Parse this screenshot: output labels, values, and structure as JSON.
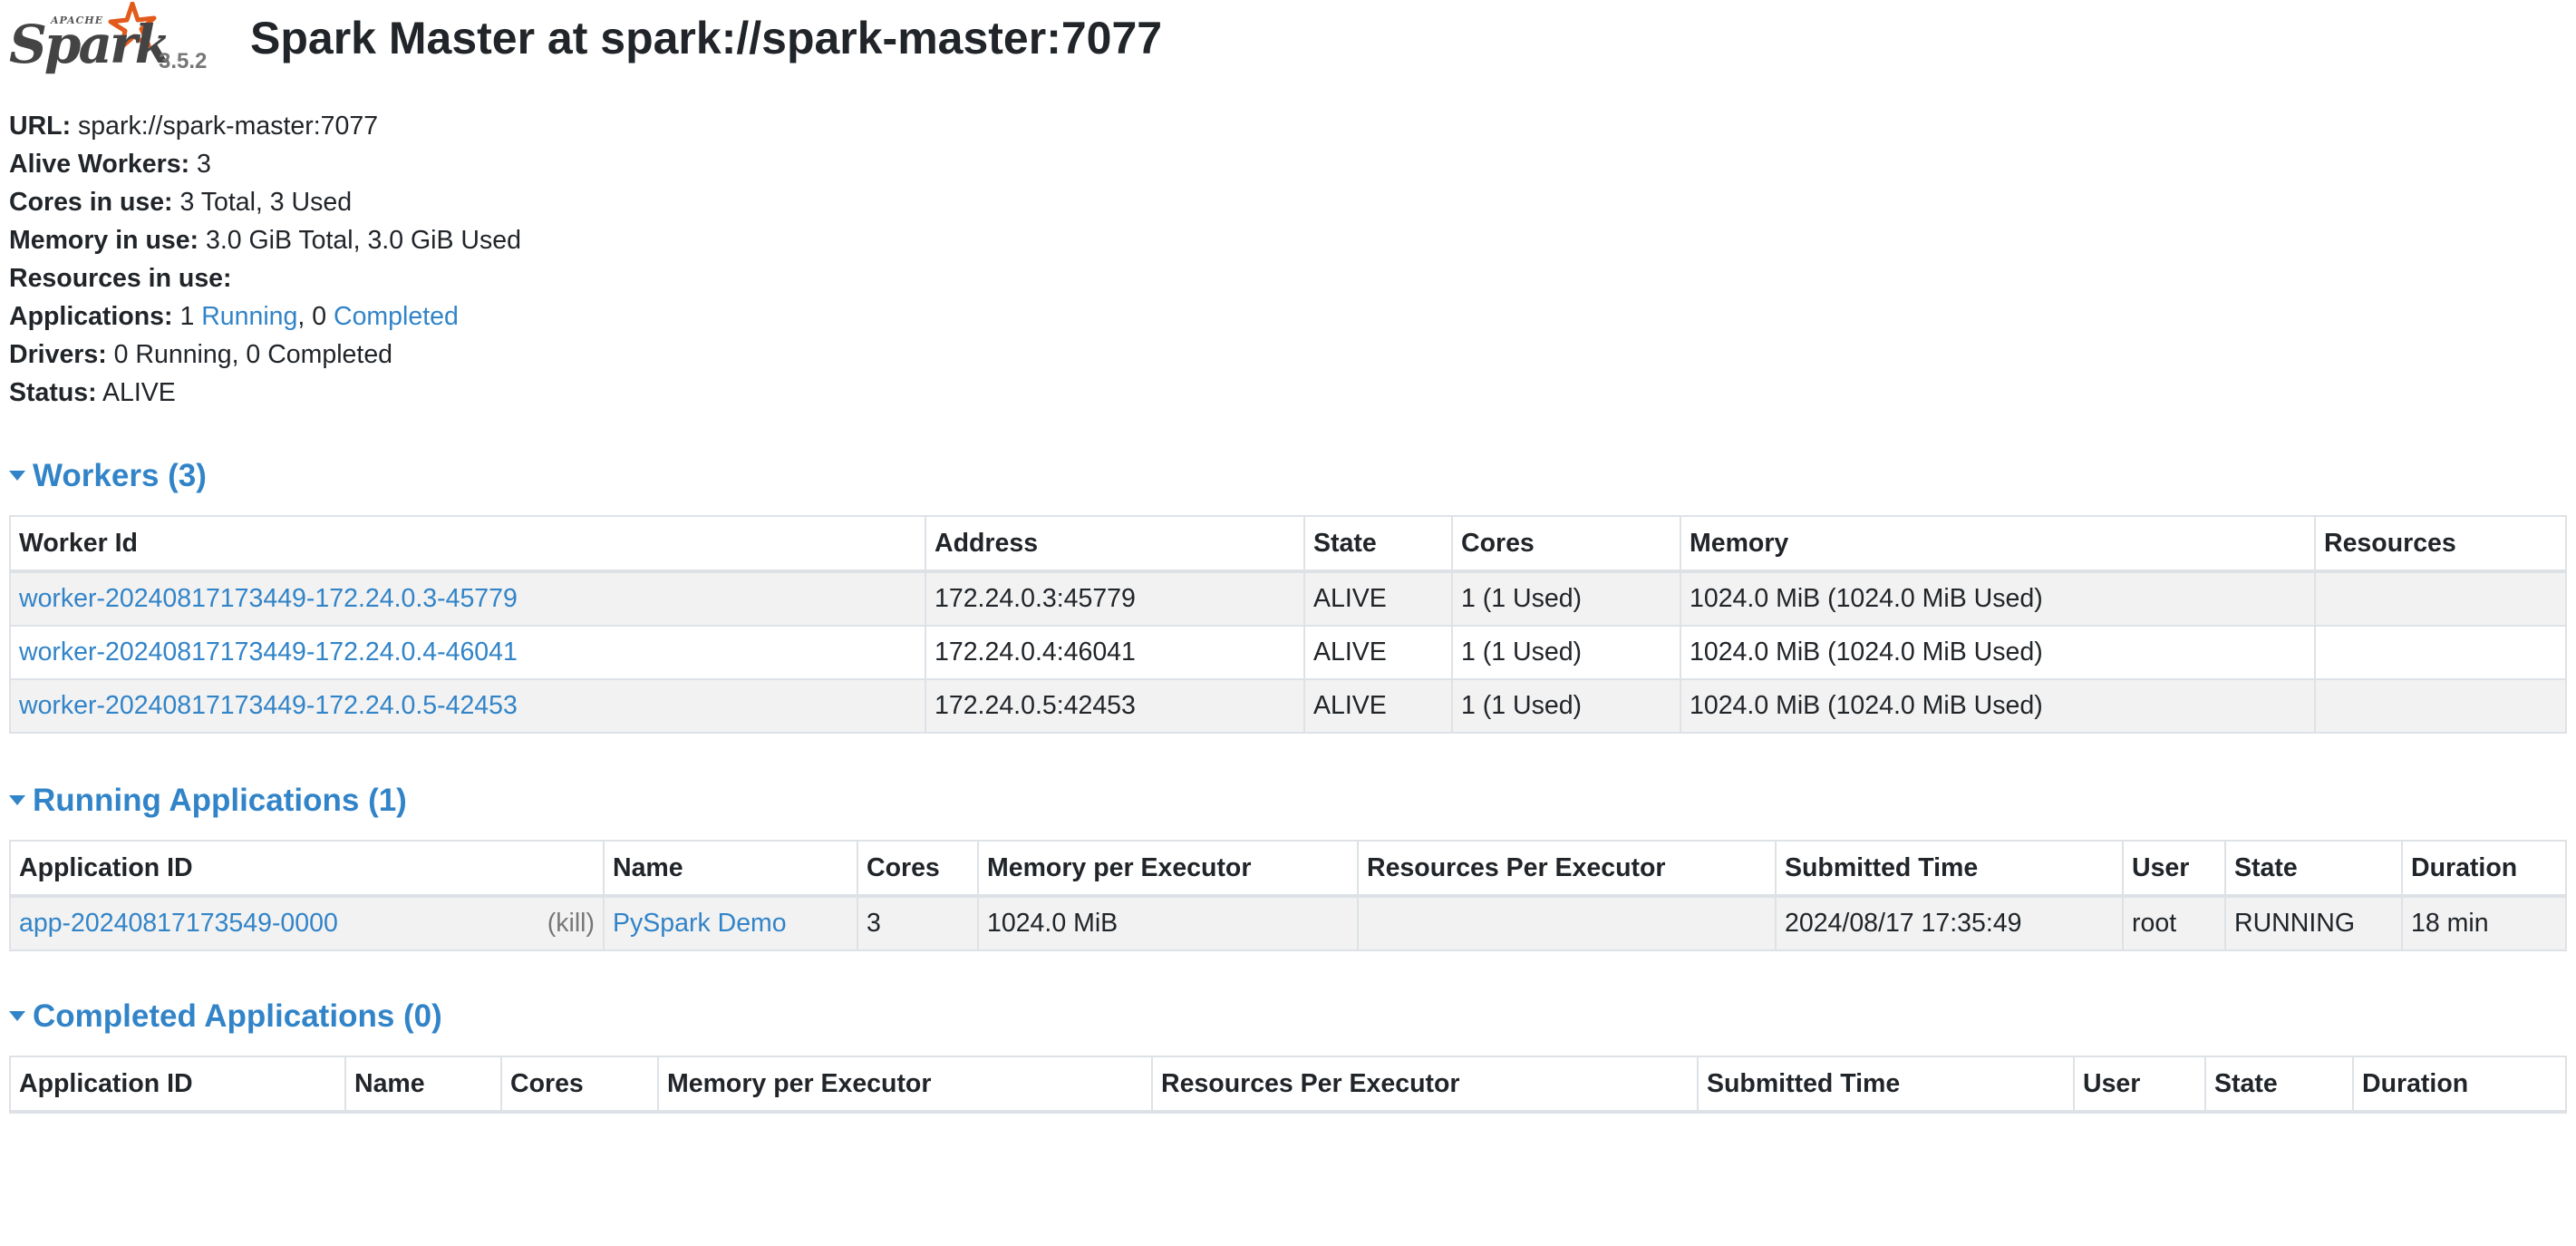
{
  "header": {
    "logo_apache": "APACHE",
    "logo_spark": "Spark",
    "version": "3.5.2",
    "title": "Spark Master at spark://spark-master:7077"
  },
  "summary": {
    "url_label": "URL:",
    "url_value": "spark://spark-master:7077",
    "alive_workers_label": "Alive Workers:",
    "alive_workers_value": "3",
    "cores_label": "Cores in use:",
    "cores_value": "3 Total, 3 Used",
    "memory_label": "Memory in use:",
    "memory_value": "3.0 GiB Total, 3.0 GiB Used",
    "resources_label": "Resources in use:",
    "applications_label": "Applications:",
    "applications_running_count": "1",
    "applications_running_link": "Running",
    "applications_sep": ", 0",
    "applications_completed_link": "Completed",
    "drivers_label": "Drivers:",
    "drivers_value": "0 Running, 0 Completed",
    "status_label": "Status:",
    "status_value": "ALIVE"
  },
  "workers": {
    "heading": "Workers (3)",
    "columns": [
      "Worker Id",
      "Address",
      "State",
      "Cores",
      "Memory",
      "Resources"
    ],
    "rows": [
      {
        "id": "worker-20240817173449-172.24.0.3-45779",
        "address": "172.24.0.3:45779",
        "state": "ALIVE",
        "cores": "1 (1 Used)",
        "memory": "1024.0 MiB (1024.0 MiB Used)",
        "resources": ""
      },
      {
        "id": "worker-20240817173449-172.24.0.4-46041",
        "address": "172.24.0.4:46041",
        "state": "ALIVE",
        "cores": "1 (1 Used)",
        "memory": "1024.0 MiB (1024.0 MiB Used)",
        "resources": ""
      },
      {
        "id": "worker-20240817173449-172.24.0.5-42453",
        "address": "172.24.0.5:42453",
        "state": "ALIVE",
        "cores": "1 (1 Used)",
        "memory": "1024.0 MiB (1024.0 MiB Used)",
        "resources": ""
      }
    ]
  },
  "running_apps": {
    "heading": "Running Applications (1)",
    "columns": [
      "Application ID",
      "Name",
      "Cores",
      "Memory per Executor",
      "Resources Per Executor",
      "Submitted Time",
      "User",
      "State",
      "Duration"
    ],
    "rows": [
      {
        "app_id": "app-20240817173549-0000",
        "kill": "(kill)",
        "name": "PySpark Demo",
        "cores": "3",
        "memory": "1024.0 MiB",
        "resources": "",
        "submitted": "2024/08/17 17:35:49",
        "user": "root",
        "state": "RUNNING",
        "duration": "18 min"
      }
    ]
  },
  "completed_apps": {
    "heading": "Completed Applications (0)",
    "columns": [
      "Application ID",
      "Name",
      "Cores",
      "Memory per Executor",
      "Resources Per Executor",
      "Submitted Time",
      "User",
      "State",
      "Duration"
    ]
  },
  "colors": {
    "link": "#3284c8",
    "stripe": "#f2f2f2",
    "border": "#dee2e6",
    "logo_star": "#e25a1c"
  }
}
